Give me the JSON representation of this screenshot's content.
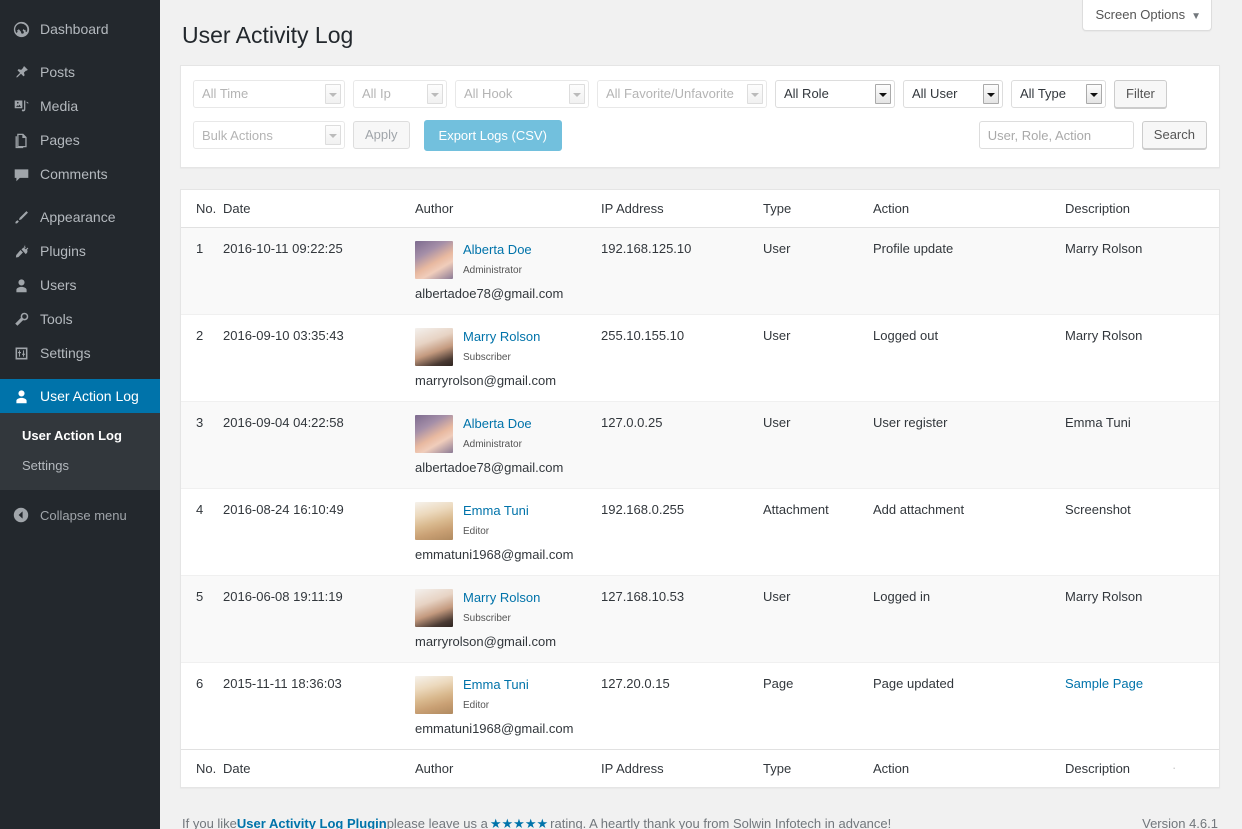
{
  "sidebar": {
    "items": [
      {
        "label": "Dashboard",
        "icon": "dashboard-icon"
      },
      {
        "label": "Posts",
        "icon": "pin-icon"
      },
      {
        "label": "Media",
        "icon": "media-icon"
      },
      {
        "label": "Pages",
        "icon": "pages-icon"
      },
      {
        "label": "Comments",
        "icon": "comments-icon"
      },
      {
        "label": "Appearance",
        "icon": "appearance-icon"
      },
      {
        "label": "Plugins",
        "icon": "plugins-icon"
      },
      {
        "label": "Users",
        "icon": "users-icon"
      },
      {
        "label": "Tools",
        "icon": "tools-icon"
      },
      {
        "label": "Settings",
        "icon": "settings-icon"
      },
      {
        "label": "User Action Log",
        "icon": "user-icon"
      }
    ],
    "submenu": [
      {
        "label": "User Action Log",
        "current": true
      },
      {
        "label": "Settings",
        "current": false
      }
    ],
    "collapse": {
      "label": "Collapse menu",
      "icon": "collapse-arrow-icon"
    },
    "active_color": "#0073aa"
  },
  "header": {
    "title": "User Activity Log",
    "screen_options": "Screen Options",
    "screen_options_caret": "▼"
  },
  "filters": {
    "time": {
      "value": "All Time",
      "disabled": true
    },
    "ip": {
      "value": "All Ip",
      "disabled": true
    },
    "hook": {
      "value": "All Hook",
      "disabled": true
    },
    "favorite": {
      "value": "All Favorite/Unfavorite",
      "disabled": true
    },
    "role": {
      "value": "All Role",
      "disabled": false
    },
    "user": {
      "value": "All User",
      "disabled": false
    },
    "type": {
      "value": "All Type",
      "disabled": false
    },
    "filter_button": "Filter",
    "bulk_actions": {
      "value": "Bulk Actions",
      "disabled": true
    },
    "apply_button": "Apply",
    "export_button": "Export Logs (CSV)",
    "export_color": "#72c0dd",
    "search_placeholder": "User, Role, Action",
    "search_value": "",
    "search_button": "Search"
  },
  "table": {
    "columns": [
      "No.",
      "Date",
      "Author",
      "IP Address",
      "Type",
      "Action",
      "Description"
    ],
    "rows": [
      {
        "no": "1",
        "date": "2016-10-11 09:22:25",
        "author_name": "Alberta Doe",
        "author_role": "Administrator",
        "author_email": "albertadoe78@gmail.com",
        "ip": "192.168.125.10",
        "type": "User",
        "action": "Profile update",
        "description": "Marry Rolson",
        "description_is_link": false
      },
      {
        "no": "2",
        "date": "2016-09-10 03:35:43",
        "author_name": "Marry Rolson",
        "author_role": "Subscriber",
        "author_email": "marryrolson@gmail.com",
        "ip": "255.10.155.10",
        "type": "User",
        "action": "Logged out",
        "description": "Marry Rolson",
        "description_is_link": false
      },
      {
        "no": "3",
        "date": "2016-09-04 04:22:58",
        "author_name": "Alberta Doe",
        "author_role": "Administrator",
        "author_email": "albertadoe78@gmail.com",
        "ip": "127.0.0.25",
        "type": "User",
        "action": "User register",
        "description": "Emma Tuni",
        "description_is_link": false
      },
      {
        "no": "4",
        "date": "2016-08-24 16:10:49",
        "author_name": "Emma Tuni",
        "author_role": "Editor",
        "author_email": "emmatuni1968@gmail.com",
        "ip": "192.168.0.255",
        "type": "Attachment",
        "action": "Add attachment",
        "description": "Screenshot",
        "description_is_link": false
      },
      {
        "no": "5",
        "date": "2016-06-08 19:11:19",
        "author_name": "Marry Rolson",
        "author_role": "Subscriber",
        "author_email": "marryrolson@gmail.com",
        "ip": "127.168.10.53",
        "type": "User",
        "action": "Logged in",
        "description": "Marry Rolson",
        "description_is_link": false
      },
      {
        "no": "6",
        "date": "2015-11-11 18:36:03",
        "author_name": "Emma Tuni",
        "author_role": "Editor",
        "author_email": "emmatuni1968@gmail.com",
        "ip": "127.20.0.15",
        "type": "Page",
        "action": "Page updated",
        "description": "Sample Page",
        "description_is_link": true
      }
    ]
  },
  "footer": {
    "prefix": "If you like ",
    "link": "User Activity Log Plugin",
    "middle": " please leave us a ",
    "stars": "★★★★★",
    "suffix": " rating. A heartly thank you from Solwin Infotech in advance!",
    "version": "Version 4.6.1"
  }
}
